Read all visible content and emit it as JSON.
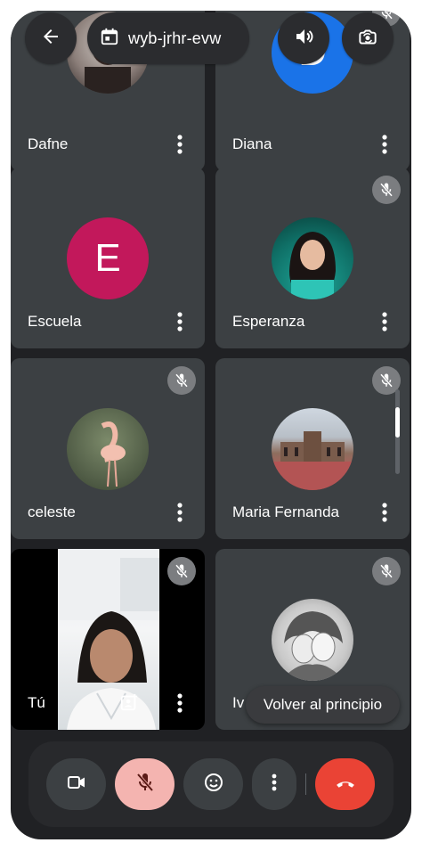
{
  "meeting": {
    "code": "wyb-jrhr-evw"
  },
  "tiles": [
    {
      "name": "Dafne"
    },
    {
      "name": "Diana",
      "initial": "D"
    },
    {
      "name": "Escuela",
      "initial": "E"
    },
    {
      "name": "Esperanza"
    },
    {
      "name": "celeste"
    },
    {
      "name": "Maria Fernanda"
    },
    {
      "name": "Tú"
    },
    {
      "name": "Iv"
    }
  ],
  "overlay": {
    "back_to_top": "Volver al principio"
  },
  "colors": {
    "background": "#202124",
    "tile": "#3c4043",
    "mic_active_bg": "#f4b4b0",
    "hangup": "#ea4335",
    "diana_avatar": "#1a73e8",
    "escuela_avatar": "#c2185b"
  },
  "icons": {
    "back": "arrow-left-icon",
    "calendar": "calendar-icon",
    "speaker": "speaker-icon",
    "switch_camera": "switch-camera-icon",
    "mic_off": "mic-off-icon",
    "more": "more-vertical-icon",
    "camera": "video-camera-icon",
    "emoji": "emoji-icon",
    "hangup": "hangup-icon",
    "photo_frame": "photo-frame-icon"
  }
}
